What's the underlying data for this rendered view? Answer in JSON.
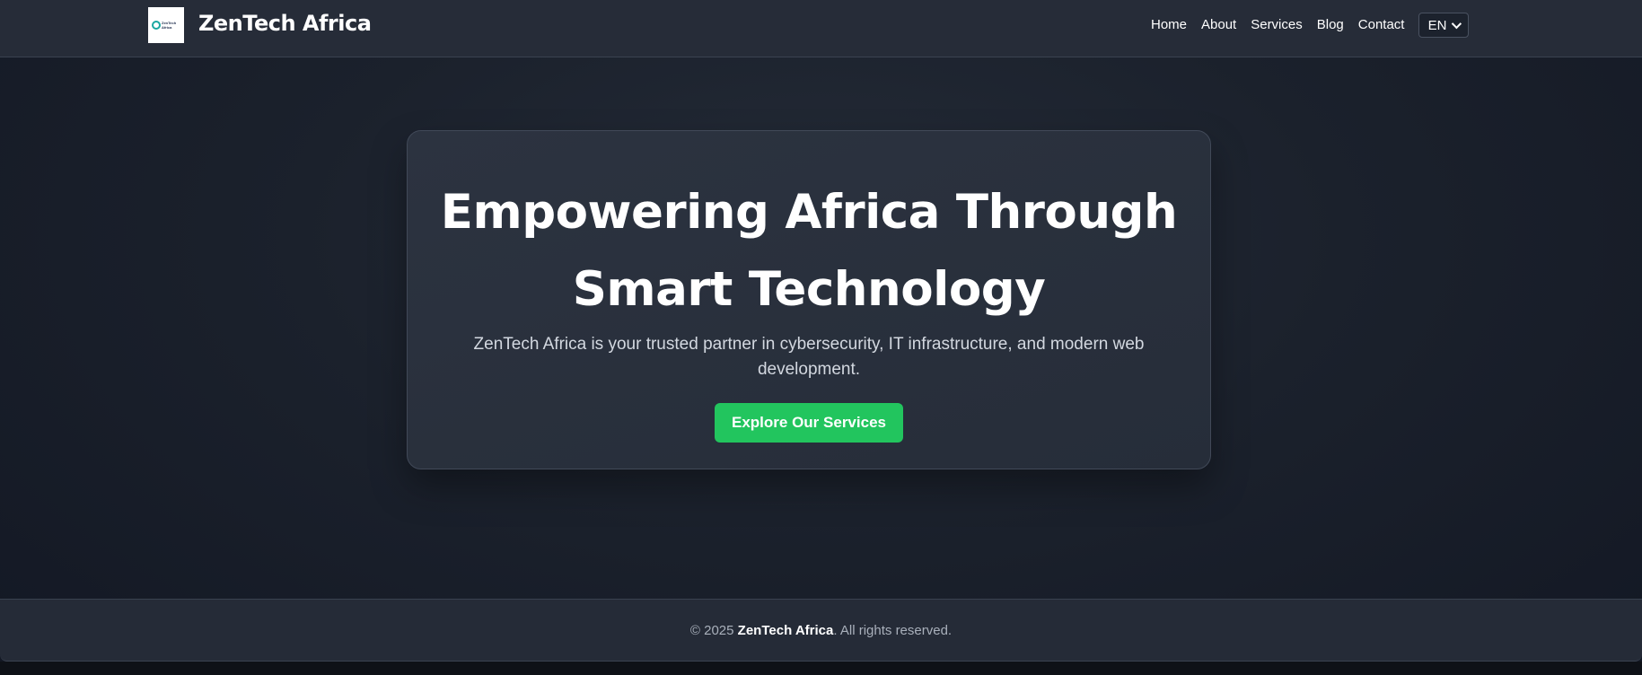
{
  "header": {
    "logo_text": "ZenTech Africa",
    "brand": "ZenTech Africa",
    "nav": [
      "Home",
      "About",
      "Services",
      "Blog",
      "Contact"
    ],
    "language": "EN"
  },
  "hero": {
    "title": "Empowering Africa Through Smart Technology",
    "subtitle": "ZenTech Africa is your trusted partner in cybersecurity, IT infrastructure, and modern web development.",
    "cta_label": "Explore Our Services"
  },
  "footer": {
    "copyright_prefix": "© 2025",
    "company": "ZenTech Africa",
    "copyright_suffix": ". All rights reserved."
  },
  "colors": {
    "accent": "#22c55e",
    "background": "#1b212c",
    "card": "#2a313d"
  }
}
